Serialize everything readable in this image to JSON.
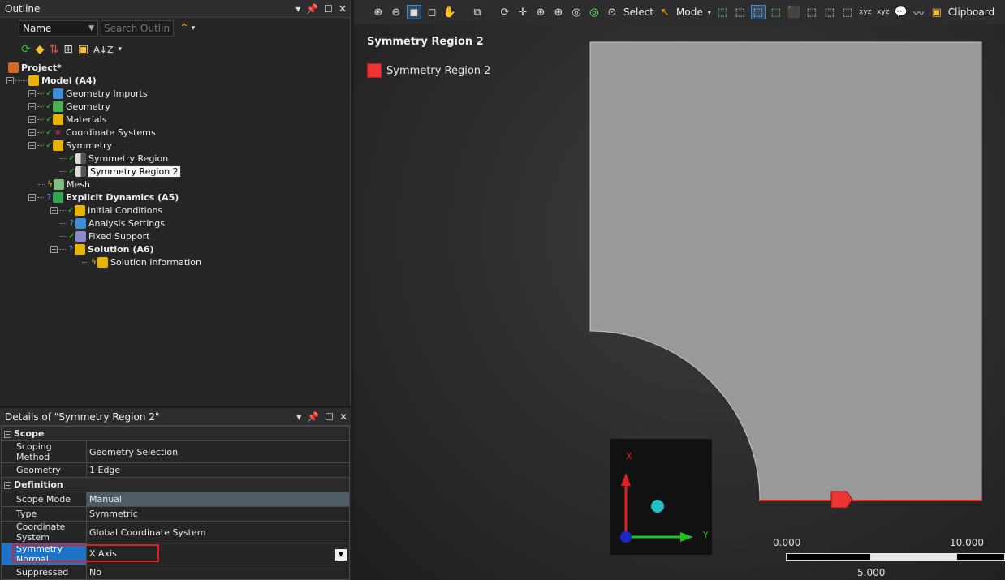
{
  "outline": {
    "title": "Outline",
    "filter_select": "Name",
    "search_placeholder": "Search Outline",
    "sort_label": "A↓Z",
    "tree": [
      {
        "label": "Project*",
        "bold": true
      },
      {
        "label": "Model (A4)",
        "bold": true
      },
      {
        "label": "Geometry Imports"
      },
      {
        "label": "Geometry"
      },
      {
        "label": "Materials"
      },
      {
        "label": "Coordinate Systems"
      },
      {
        "label": "Symmetry"
      },
      {
        "label": "Symmetry Region"
      },
      {
        "label": "Symmetry Region 2",
        "selected": true
      },
      {
        "label": "Mesh"
      },
      {
        "label": "Explicit Dynamics (A5)",
        "bold": true
      },
      {
        "label": "Initial Conditions"
      },
      {
        "label": "Analysis Settings"
      },
      {
        "label": "Fixed Support"
      },
      {
        "label": "Solution (A6)",
        "bold": true
      },
      {
        "label": "Solution Information"
      }
    ]
  },
  "details": {
    "title": "Details of \"Symmetry Region 2\"",
    "sections": [
      {
        "name": "Scope",
        "rows": [
          {
            "label": "Scoping Method",
            "value": "Geometry Selection"
          },
          {
            "label": "Geometry",
            "value": "1 Edge"
          }
        ]
      },
      {
        "name": "Definition",
        "rows": [
          {
            "label": "Scope Mode",
            "value": "Manual"
          },
          {
            "label": "Type",
            "value": "Symmetric"
          },
          {
            "label": "Coordinate System",
            "value": "Global Coordinate System"
          },
          {
            "label": "Symmetry Normal",
            "value": "X Axis"
          },
          {
            "label": "Suppressed",
            "value": "No"
          }
        ]
      }
    ]
  },
  "toolbar": {
    "select_label": "Select",
    "mode_label": "Mode",
    "clipboard_label": "Clipboard"
  },
  "viewport": {
    "legend_title": "Symmetry Region 2",
    "legend_item": "Symmetry Region 2",
    "legend_color": "#ee3333",
    "geometry_color": "#999999",
    "triad": {
      "x_label": "X",
      "y_label": "Y"
    },
    "scale": {
      "left": "0.000",
      "right": "10.000",
      "mid": "5.000"
    }
  }
}
